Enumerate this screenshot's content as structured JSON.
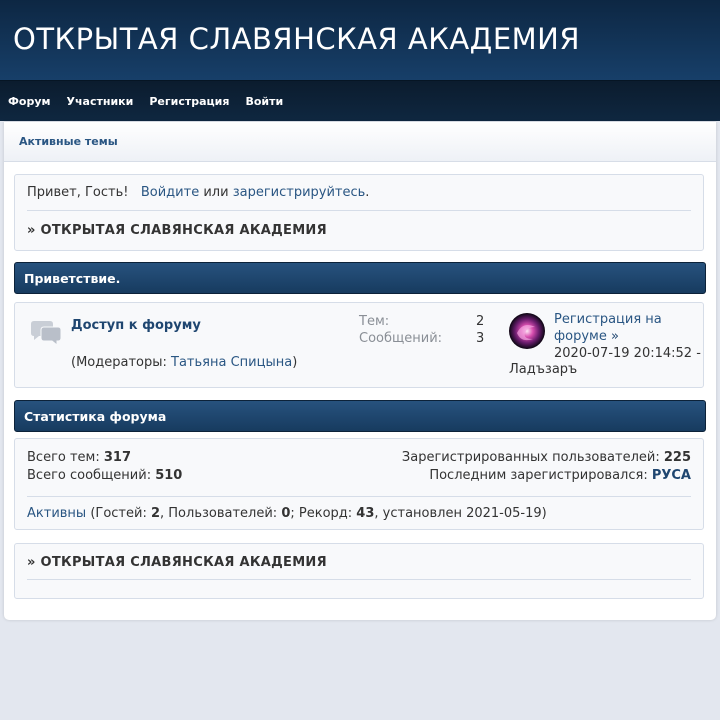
{
  "header": {
    "site_title": "ОТКРЫТАЯ СЛАВЯНСКАЯ АКАДЕМИЯ"
  },
  "nav": {
    "items": [
      "Форум",
      "Участники",
      "Регистрация",
      "Войти"
    ]
  },
  "breadcrumb": {
    "active_topics": "Активные темы"
  },
  "welcome": {
    "greeting": "Привет, Гость!",
    "login_link": "Войдите",
    "or_text": " или ",
    "register_link": "зарегистрируйтесь",
    "period": ".",
    "forum_title": "» ОТКРЫТАЯ СЛАВЯНСКАЯ АКАДЕМИЯ"
  },
  "category": {
    "title": "Приветствие.",
    "forum": {
      "name": "Доступ к форуму",
      "moderators_prefix": "(Модераторы: ",
      "moderator_name": "Татьяна Спицына",
      "moderators_suffix": ")",
      "topics_label": "Тем:",
      "topics_value": "2",
      "posts_label": "Сообщений:",
      "posts_value": "3",
      "last_post_title_1": "Регистрация на",
      "last_post_title_2": "форуме",
      "last_post_arrow": "»",
      "last_post_date": "2020-07-19 20:14:52 -",
      "last_post_author": "Ладъзаръ"
    }
  },
  "stats": {
    "title": "Статистика форума",
    "total_topics_label": "Всего тем: ",
    "total_topics": "317",
    "total_posts_label": "Всего сообщений: ",
    "total_posts": "510",
    "registered_label": "Зарегистрированных пользователей: ",
    "registered": "225",
    "last_registered_label": "Последним зарегистрировался: ",
    "last_registered": "РУСА",
    "active_link": "Активны",
    "guests_label": " (Гостей: ",
    "guests": "2",
    "users_label": ", Пользователей: ",
    "users": "0",
    "record_label": "; Рекорд: ",
    "record": "43",
    "record_set_label": ", установлен 2021-05-19)"
  },
  "footer_box": {
    "forum_title": "» ОТКРЫТАЯ СЛАВЯНСКАЯ АКАДЕМИЯ"
  },
  "colors": {
    "header": "#173f69",
    "navbar": "#0b1c2e",
    "link": "#2a5683",
    "category": "#27527e"
  }
}
